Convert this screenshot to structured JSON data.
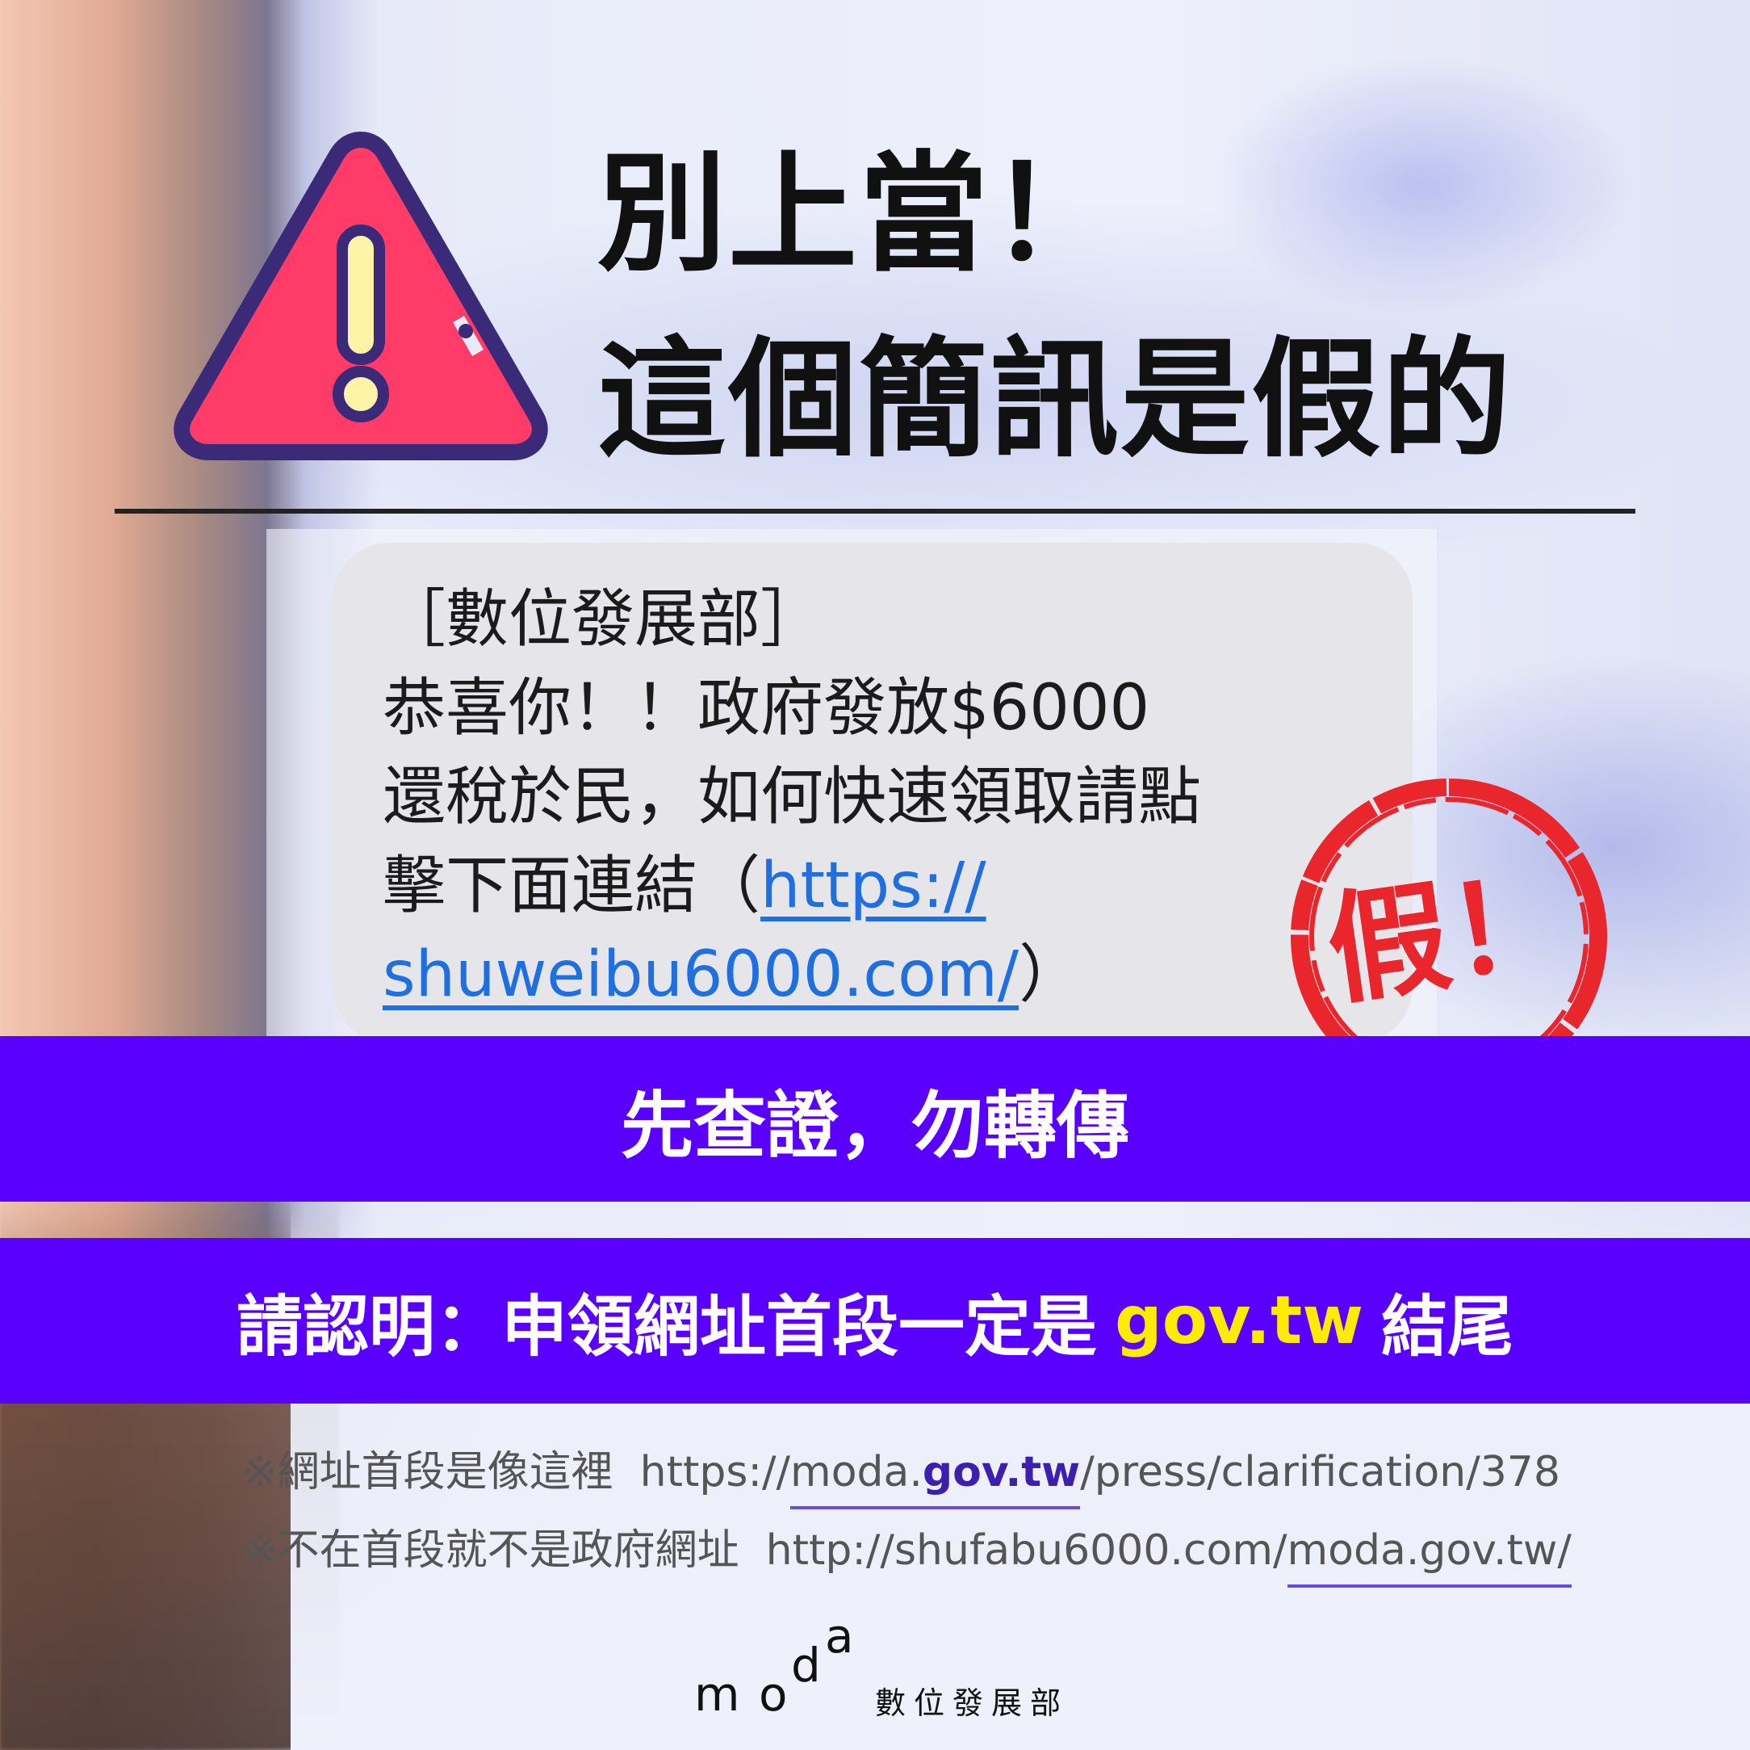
{
  "headline": {
    "line1": "別上當！",
    "line2": "這個簡訊是假的"
  },
  "sms": {
    "line1": "［數位發展部］",
    "line2": "恭喜你！！政府發放$6000",
    "line3": "還稅於民，如何快速領取請點",
    "line4_text": "擊下面連結（",
    "link_part1": "https://",
    "link_part2": "shuweibu6000.com/",
    "closing": "）"
  },
  "stamp": {
    "label": "假！",
    "color": "#e8262c"
  },
  "banner1": {
    "text": "先查證，勿轉傳"
  },
  "banner2": {
    "prefix": "請認明：申領網址首段一定是",
    "accent": "gov.tw",
    "suffix": "結尾"
  },
  "notes": {
    "note1": {
      "label": "※網址首段是像這裡",
      "url_before": "https://",
      "url_underlined_a": "moda.",
      "url_highlight": "gov.tw",
      "url_after": "/press/clarification/378"
    },
    "note2": {
      "label": "※不在首段就不是政府網址",
      "url_before": "http://shufabu6000.com/",
      "url_underlined": "moda.gov.tw/"
    }
  },
  "logo": {
    "mark_m": "m",
    "mark_o": "o",
    "mark_d": "d",
    "mark_a": "a",
    "text": "數位發展部"
  },
  "colors": {
    "banner": "#5a00ff",
    "accent_yellow": "#ffeb00",
    "warning_fill": "#ff3b67",
    "warning_outline": "#3a2a78",
    "link_blue": "#1f6fe0"
  },
  "icons": [
    "warning-icon",
    "fake-stamp-icon"
  ]
}
